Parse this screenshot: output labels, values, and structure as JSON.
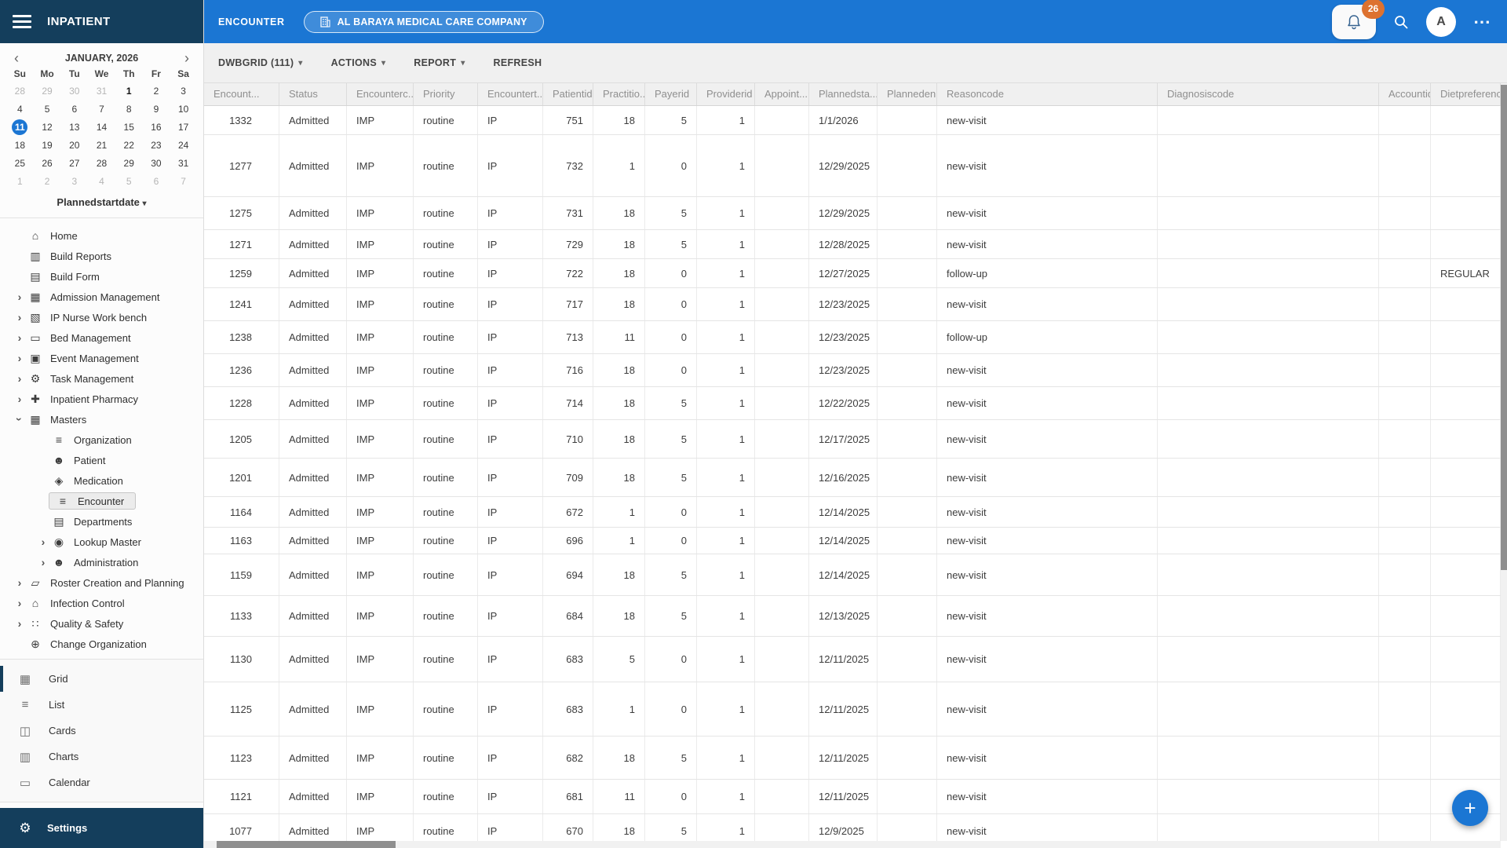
{
  "app": {
    "title": "INPATIENT"
  },
  "topbar": {
    "page_label": "ENCOUNTER",
    "org_button_label": "AL BARAYA MEDICAL CARE COMPANY",
    "notification_count": "26",
    "avatar_letter": "A",
    "accent_blue": "#1b76d3",
    "navy": "#143e5c",
    "badge_orange": "#dd7230"
  },
  "calendar": {
    "title": "JANUARY, 2026",
    "prev_arrow": "‹",
    "next_arrow": "›",
    "day_headers": [
      "Su",
      "Mo",
      "Tu",
      "We",
      "Th",
      "Fr",
      "Sa"
    ],
    "dates": [
      {
        "d": "28",
        "muted": true
      },
      {
        "d": "29",
        "muted": true
      },
      {
        "d": "30",
        "muted": true
      },
      {
        "d": "31",
        "muted": true
      },
      {
        "d": "1",
        "bold": true
      },
      {
        "d": "2"
      },
      {
        "d": "3"
      },
      {
        "d": "4"
      },
      {
        "d": "5"
      },
      {
        "d": "6"
      },
      {
        "d": "7"
      },
      {
        "d": "8"
      },
      {
        "d": "9"
      },
      {
        "d": "10"
      },
      {
        "d": "11",
        "selected": true
      },
      {
        "d": "12"
      },
      {
        "d": "13"
      },
      {
        "d": "14"
      },
      {
        "d": "15"
      },
      {
        "d": "16"
      },
      {
        "d": "17"
      },
      {
        "d": "18"
      },
      {
        "d": "19"
      },
      {
        "d": "20"
      },
      {
        "d": "21"
      },
      {
        "d": "22"
      },
      {
        "d": "23"
      },
      {
        "d": "24"
      },
      {
        "d": "25"
      },
      {
        "d": "26"
      },
      {
        "d": "27"
      },
      {
        "d": "28"
      },
      {
        "d": "29"
      },
      {
        "d": "30"
      },
      {
        "d": "31"
      },
      {
        "d": "1",
        "muted": true
      },
      {
        "d": "2",
        "muted": true
      },
      {
        "d": "3",
        "muted": true
      },
      {
        "d": "4",
        "muted": true
      },
      {
        "d": "5",
        "muted": true
      },
      {
        "d": "6",
        "muted": true
      },
      {
        "d": "7",
        "muted": true
      }
    ],
    "footer_label": "Plannedstartdate",
    "footer_caret": "▾"
  },
  "sidebar": {
    "menu": [
      {
        "label": "Home",
        "icon": "home-icon",
        "glyph": "⌂"
      },
      {
        "label": "Build Reports",
        "icon": "bar-chart-icon",
        "glyph": "▥"
      },
      {
        "label": "Build Form",
        "icon": "form-icon",
        "glyph": "▤"
      },
      {
        "label": "Admission Management",
        "icon": "admission-management-icon",
        "glyph": "▦",
        "chevron": "right"
      },
      {
        "label": "IP Nurse Work bench",
        "icon": "nurse-workbench-icon",
        "glyph": "▧",
        "chevron": "right"
      },
      {
        "label": "Bed Management",
        "icon": "bed-management-icon",
        "glyph": "▭",
        "chevron": "right"
      },
      {
        "label": "Event Management",
        "icon": "event-management-icon",
        "glyph": "▣",
        "chevron": "right"
      },
      {
        "label": "Task Management",
        "icon": "gear-icon",
        "glyph": "⚙",
        "chevron": "right"
      },
      {
        "label": "Inpatient Pharmacy",
        "icon": "pharmacy-icon",
        "glyph": "✚",
        "chevron": "right"
      },
      {
        "label": "Masters",
        "icon": "masters-icon",
        "glyph": "▦",
        "chevron": "down"
      },
      {
        "label": "Organization",
        "icon": "organization-icon",
        "glyph": "≡",
        "sub": true
      },
      {
        "label": "Patient",
        "icon": "patient-icon",
        "glyph": "☻",
        "sub": true
      },
      {
        "label": "Medication",
        "icon": "medication-icon",
        "glyph": "◈",
        "sub": true
      },
      {
        "label": "Encounter",
        "icon": "encounter-icon",
        "glyph": "≡",
        "sub": true,
        "selected": true
      },
      {
        "label": "Departments",
        "icon": "departments-icon",
        "glyph": "▤",
        "sub": true
      },
      {
        "label": "Lookup Master",
        "icon": "lookup-master-icon",
        "glyph": "◉",
        "sub": true,
        "chevron": "right"
      },
      {
        "label": "Administration",
        "icon": "administration-icon",
        "glyph": "☻",
        "sub": true,
        "chevron": "right"
      },
      {
        "label": "Roster Creation and Planning",
        "icon": "roster-icon",
        "glyph": "▱",
        "chevron": "right"
      },
      {
        "label": "Infection Control",
        "icon": "infection-control-icon",
        "glyph": "⌂",
        "chevron": "right"
      },
      {
        "label": "Quality & Safety",
        "icon": "quality-safety-icon",
        "glyph": "∷",
        "chevron": "right"
      },
      {
        "label": "Change Organization",
        "icon": "globe-icon",
        "glyph": "⊕"
      }
    ],
    "views": [
      {
        "label": "Grid",
        "icon": "grid-view-icon",
        "glyph": "▦",
        "active": true
      },
      {
        "label": "List",
        "icon": "list-view-icon",
        "glyph": "≡"
      },
      {
        "label": "Cards",
        "icon": "cards-view-icon",
        "glyph": "◫"
      },
      {
        "label": "Charts",
        "icon": "charts-view-icon",
        "glyph": "▥"
      },
      {
        "label": "Calendar",
        "icon": "calendar-view-icon",
        "glyph": "▭"
      }
    ],
    "settings_label": "Settings",
    "settings_glyph": "⚙"
  },
  "toolbar": {
    "items": [
      {
        "label": "DWBGRID (111)",
        "caret": true
      },
      {
        "label": "ACTIONS",
        "caret": true
      },
      {
        "label": "REPORT",
        "caret": true
      },
      {
        "label": "REFRESH",
        "caret": false
      }
    ]
  },
  "grid": {
    "columns": [
      "Encount...",
      "Status",
      "Encounterc...",
      "Priority",
      "Encountert...",
      "Patientid",
      "Practitio...",
      "Payerid",
      "Providerid",
      "Appoint...",
      "Plannedsta...",
      "Planneden...",
      "Reasoncode",
      "Diagnosiscode",
      "Accountid",
      "Dietpreferencec"
    ],
    "rows": [
      [
        "1332",
        "Admitted",
        "IMP",
        "routine",
        "IP",
        "751",
        "18",
        "5",
        "1",
        "",
        "1/1/2026",
        "",
        "new-visit",
        "",
        "",
        ""
      ],
      [
        "1277",
        "Admitted",
        "IMP",
        "routine",
        "IP",
        "732",
        "1",
        "0",
        "1",
        "",
        "12/29/2025",
        "",
        "new-visit",
        "",
        "",
        ""
      ],
      [
        "1275",
        "Admitted",
        "IMP",
        "routine",
        "IP",
        "731",
        "18",
        "5",
        "1",
        "",
        "12/29/2025",
        "",
        "new-visit",
        "",
        "",
        ""
      ],
      [
        "1271",
        "Admitted",
        "IMP",
        "routine",
        "IP",
        "729",
        "18",
        "5",
        "1",
        "",
        "12/28/2025",
        "",
        "new-visit",
        "",
        "",
        ""
      ],
      [
        "1259",
        "Admitted",
        "IMP",
        "routine",
        "IP",
        "722",
        "18",
        "0",
        "1",
        "",
        "12/27/2025",
        "",
        "follow-up",
        "",
        "",
        "REGULAR"
      ],
      [
        "1241",
        "Admitted",
        "IMP",
        "routine",
        "IP",
        "717",
        "18",
        "0",
        "1",
        "",
        "12/23/2025",
        "",
        "new-visit",
        "",
        "",
        ""
      ],
      [
        "1238",
        "Admitted",
        "IMP",
        "routine",
        "IP",
        "713",
        "11",
        "0",
        "1",
        "",
        "12/23/2025",
        "",
        "follow-up",
        "",
        "",
        ""
      ],
      [
        "1236",
        "Admitted",
        "IMP",
        "routine",
        "IP",
        "716",
        "18",
        "0",
        "1",
        "",
        "12/23/2025",
        "",
        "new-visit",
        "",
        "",
        ""
      ],
      [
        "1228",
        "Admitted",
        "IMP",
        "routine",
        "IP",
        "714",
        "18",
        "5",
        "1",
        "",
        "12/22/2025",
        "",
        "new-visit",
        "",
        "",
        ""
      ],
      [
        "1205",
        "Admitted",
        "IMP",
        "routine",
        "IP",
        "710",
        "18",
        "5",
        "1",
        "",
        "12/17/2025",
        "",
        "new-visit",
        "",
        "",
        ""
      ],
      [
        "1201",
        "Admitted",
        "IMP",
        "routine",
        "IP",
        "709",
        "18",
        "5",
        "1",
        "",
        "12/16/2025",
        "",
        "new-visit",
        "",
        "",
        ""
      ],
      [
        "1164",
        "Admitted",
        "IMP",
        "routine",
        "IP",
        "672",
        "1",
        "0",
        "1",
        "",
        "12/14/2025",
        "",
        "new-visit",
        "",
        "",
        ""
      ],
      [
        "1163",
        "Admitted",
        "IMP",
        "routine",
        "IP",
        "696",
        "1",
        "0",
        "1",
        "",
        "12/14/2025",
        "",
        "new-visit",
        "",
        "",
        ""
      ],
      [
        "1159",
        "Admitted",
        "IMP",
        "routine",
        "IP",
        "694",
        "18",
        "5",
        "1",
        "",
        "12/14/2025",
        "",
        "new-visit",
        "",
        "",
        ""
      ],
      [
        "1133",
        "Admitted",
        "IMP",
        "routine",
        "IP",
        "684",
        "18",
        "5",
        "1",
        "",
        "12/13/2025",
        "",
        "new-visit",
        "",
        "",
        ""
      ],
      [
        "1130",
        "Admitted",
        "IMP",
        "routine",
        "IP",
        "683",
        "5",
        "0",
        "1",
        "",
        "12/11/2025",
        "",
        "new-visit",
        "",
        "",
        ""
      ],
      [
        "1125",
        "Admitted",
        "IMP",
        "routine",
        "IP",
        "683",
        "1",
        "0",
        "1",
        "",
        "12/11/2025",
        "",
        "new-visit",
        "",
        "",
        ""
      ],
      [
        "1123",
        "Admitted",
        "IMP",
        "routine",
        "IP",
        "682",
        "18",
        "5",
        "1",
        "",
        "12/11/2025",
        "",
        "new-visit",
        "",
        "",
        ""
      ],
      [
        "1121",
        "Admitted",
        "IMP",
        "routine",
        "IP",
        "681",
        "11",
        "0",
        "1",
        "",
        "12/11/2025",
        "",
        "new-visit",
        "",
        "",
        ""
      ],
      [
        "1077",
        "Admitted",
        "IMP",
        "routine",
        "IP",
        "670",
        "18",
        "5",
        "1",
        "",
        "12/9/2025",
        "",
        "new-visit",
        "",
        "",
        ""
      ]
    ]
  }
}
